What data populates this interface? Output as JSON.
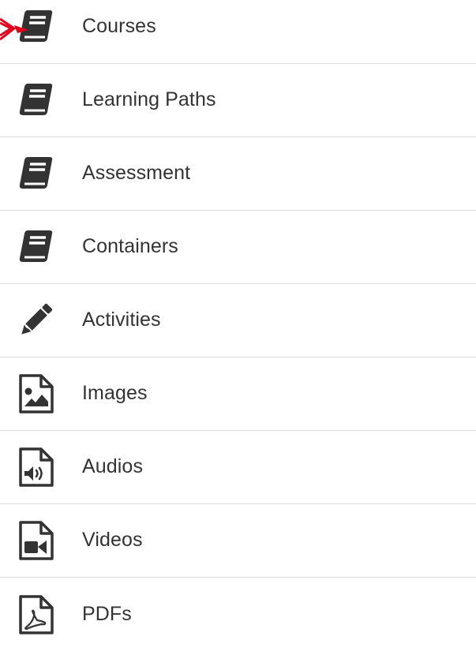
{
  "menu": {
    "items": [
      {
        "label": "Courses",
        "icon": "book-icon"
      },
      {
        "label": "Learning Paths",
        "icon": "book-icon"
      },
      {
        "label": "Assessment",
        "icon": "book-icon"
      },
      {
        "label": "Containers",
        "icon": "book-icon"
      },
      {
        "label": "Activities",
        "icon": "pencil-icon"
      },
      {
        "label": "Images",
        "icon": "image-file-icon"
      },
      {
        "label": "Audios",
        "icon": "audio-file-icon"
      },
      {
        "label": "Videos",
        "icon": "video-file-icon"
      },
      {
        "label": "PDFs",
        "icon": "pdf-file-icon"
      }
    ]
  },
  "annotation": {
    "color": "#e0001b"
  },
  "colors": {
    "icon": "#333333",
    "text": "#333333",
    "divider": "#dcdcdc",
    "background": "#ffffff"
  }
}
